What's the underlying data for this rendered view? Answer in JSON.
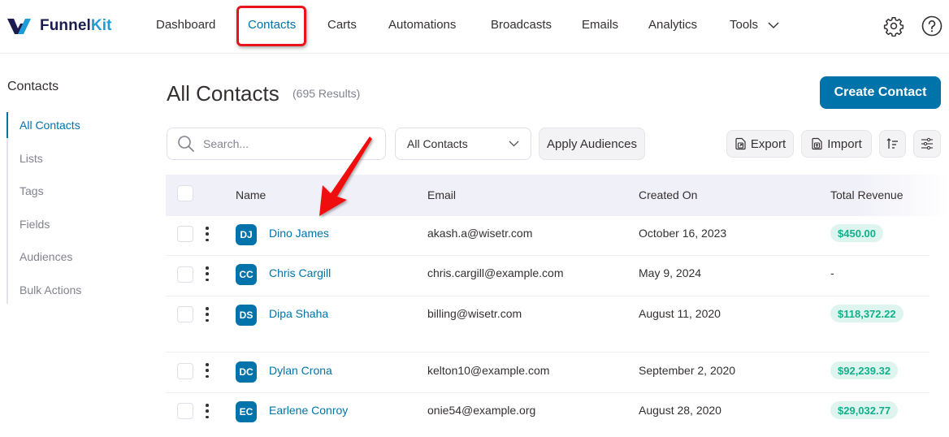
{
  "brand": {
    "name_part1": "Funnel",
    "name_part2": "Kit",
    "primary_color": "#0073aa",
    "accent_color": "#1f9bd8"
  },
  "nav": {
    "items": [
      {
        "label": "Dashboard",
        "active": false
      },
      {
        "label": "Contacts",
        "active": true
      },
      {
        "label": "Carts",
        "active": false
      },
      {
        "label": "Automations",
        "active": false
      },
      {
        "label": "Broadcasts",
        "active": false
      },
      {
        "label": "Emails",
        "active": false
      },
      {
        "label": "Analytics",
        "active": false
      },
      {
        "label": "Tools",
        "active": false,
        "has_dropdown": true
      }
    ],
    "right_icons": [
      "gear-icon",
      "help-icon"
    ]
  },
  "sidebar": {
    "title": "Contacts",
    "items": [
      {
        "label": "All Contacts",
        "active": true
      },
      {
        "label": "Lists"
      },
      {
        "label": "Tags"
      },
      {
        "label": "Fields"
      },
      {
        "label": "Audiences"
      },
      {
        "label": "Bulk Actions"
      }
    ]
  },
  "header": {
    "title": "All Contacts",
    "result_count": "(695 Results)",
    "create_button": "Create Contact"
  },
  "filters": {
    "search_placeholder": "Search...",
    "search_value": "",
    "audience_select": "All Contacts",
    "apply_button": "Apply Audiences",
    "export_button": "Export",
    "import_button": "Import"
  },
  "table": {
    "columns": [
      "Name",
      "Email",
      "Created On",
      "Total Revenue"
    ],
    "rows": [
      {
        "initials": "DJ",
        "name": "Dino James",
        "email": "akash.a@wisetr.com",
        "created": "October 16, 2023",
        "revenue": "$450.00"
      },
      {
        "initials": "CC",
        "name": "Chris Cargill",
        "email": "chris.cargill@example.com",
        "created": "May 9, 2024",
        "revenue": "-"
      },
      {
        "initials": "DS",
        "name": "Dipa Shaha",
        "email": "billing@wisetr.com",
        "created": "August 11, 2020",
        "revenue": "$118,372.22"
      },
      {
        "initials": "DC",
        "name": "Dylan Crona",
        "email": "kelton10@example.com",
        "created": "September 2, 2020",
        "revenue": "$92,239.32"
      },
      {
        "initials": "EC",
        "name": "Earlene Conroy",
        "email": "onie54@example.org",
        "created": "August 28, 2020",
        "revenue": "$29,032.77"
      }
    ]
  },
  "annotations": {
    "highlight_color": "#e8141c"
  }
}
